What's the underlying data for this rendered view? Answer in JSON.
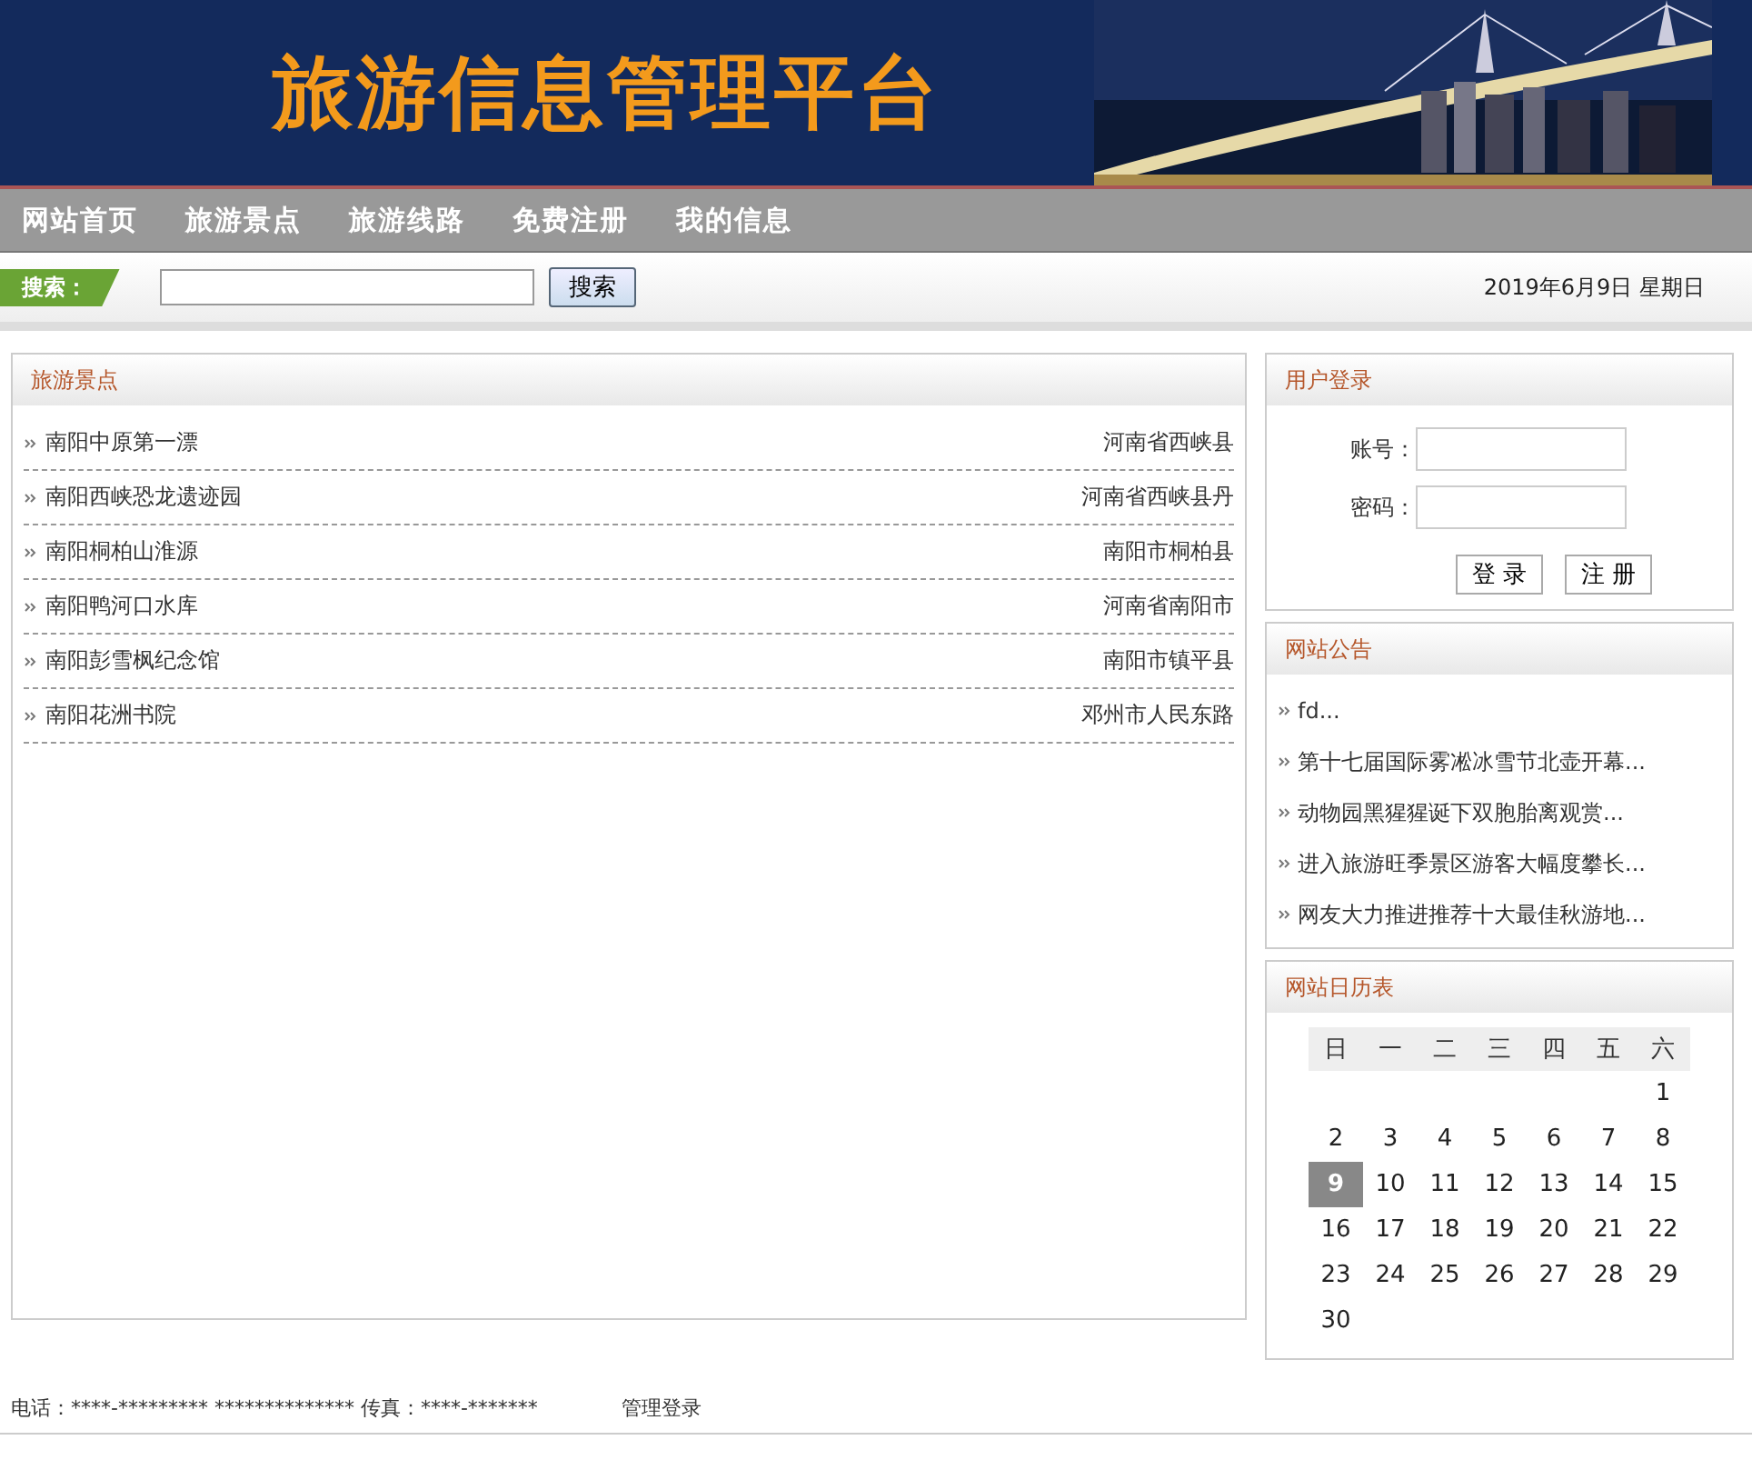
{
  "banner": {
    "title": "旅游信息管理平台",
    "kind": "picture"
  },
  "nav": [
    {
      "label": "网站首页"
    },
    {
      "label": "旅游景点"
    },
    {
      "label": "旅游线路"
    },
    {
      "label": "免费注册"
    },
    {
      "label": "我的信息"
    }
  ],
  "search": {
    "label": "搜索：",
    "button": "搜索",
    "date": "2019年6月9日 星期日"
  },
  "attractions": {
    "title": "旅游景点",
    "items": [
      {
        "name": "南阳中原第一漂",
        "location": "河南省西峡县"
      },
      {
        "name": "南阳西峡恐龙遗迹园",
        "location": "河南省西峡县丹"
      },
      {
        "name": "南阳桐柏山淮源",
        "location": "南阳市桐柏县"
      },
      {
        "name": "南阳鸭河口水库",
        "location": "河南省南阳市"
      },
      {
        "name": "南阳彭雪枫纪念馆",
        "location": "南阳市镇平县"
      },
      {
        "name": "南阳花洲书院",
        "location": "邓州市人民东路"
      }
    ]
  },
  "login": {
    "title": "用户登录",
    "fields": [
      {
        "label": "账号："
      },
      {
        "label": "密码："
      }
    ],
    "buttons": [
      "登 录",
      "注 册"
    ]
  },
  "notices": {
    "title": "网站公告",
    "items": [
      "fd...",
      "第十七届国际雾凇冰雪节北壶开幕...",
      "动物园黑猩猩诞下双胞胎离观赏...",
      "进入旅游旺季景区游客大幅度攀长...",
      "网友大力推进推荐十大最佳秋游地..."
    ]
  },
  "calendar": {
    "title": "网站日历表",
    "headers": [
      "日",
      "一",
      "二",
      "三",
      "四",
      "五",
      "六"
    ],
    "weeks": [
      {
        "kind": "first",
        "days": [
          {
            "day": "1",
            "selected": false
          }
        ]
      },
      {
        "kind": "full",
        "days": [
          {
            "day": "2",
            "selected": false
          },
          {
            "day": "3",
            "selected": false
          },
          {
            "day": "4",
            "selected": false
          },
          {
            "day": "5",
            "selected": false
          },
          {
            "day": "6",
            "selected": false
          },
          {
            "day": "7",
            "selected": false
          },
          {
            "day": "8",
            "selected": false
          }
        ]
      },
      {
        "kind": "full",
        "days": [
          {
            "day": "9",
            "selected": true
          },
          {
            "day": "10",
            "selected": false
          },
          {
            "day": "11",
            "selected": false
          },
          {
            "day": "12",
            "selected": false
          },
          {
            "day": "13",
            "selected": false
          },
          {
            "day": "14",
            "selected": false
          },
          {
            "day": "15",
            "selected": false
          }
        ]
      },
      {
        "kind": "full",
        "days": [
          {
            "day": "16",
            "selected": false
          },
          {
            "day": "17",
            "selected": false
          },
          {
            "day": "18",
            "selected": false
          },
          {
            "day": "19",
            "selected": false
          },
          {
            "day": "20",
            "selected": false
          },
          {
            "day": "21",
            "selected": false
          },
          {
            "day": "22",
            "selected": false
          }
        ]
      },
      {
        "kind": "full",
        "days": [
          {
            "day": "23",
            "selected": false
          },
          {
            "day": "24",
            "selected": false
          },
          {
            "day": "25",
            "selected": false
          },
          {
            "day": "26",
            "selected": false
          },
          {
            "day": "27",
            "selected": false
          },
          {
            "day": "28",
            "selected": false
          },
          {
            "day": "29",
            "selected": false
          }
        ]
      },
      {
        "kind": "last",
        "days": [
          {
            "day": "30",
            "selected": false
          }
        ]
      }
    ]
  },
  "footer": {
    "contact": "电话：****-********* ************** 传真：****-*******",
    "admin_link": "管理登录"
  }
}
